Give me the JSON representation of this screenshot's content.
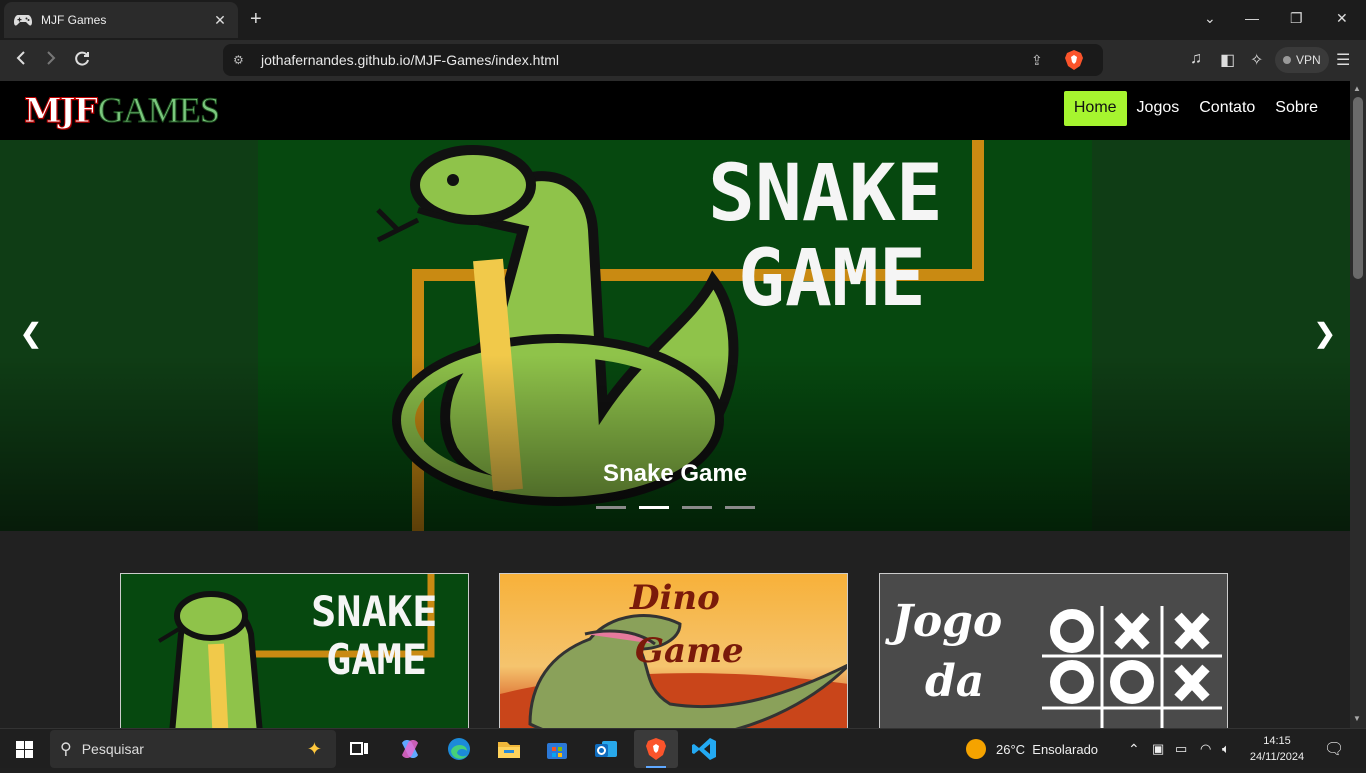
{
  "browser": {
    "tab_title": "MJF Games",
    "url": "jothafernandes.github.io/MJF-Games/index.html",
    "vpn_label": "VPN"
  },
  "site": {
    "logo_mjf": "MJF",
    "logo_games": "GAMES",
    "menu": [
      "Home",
      "Jogos",
      "Contato",
      "Sobre"
    ],
    "active_menu": "Home"
  },
  "carousel": {
    "caption": "Snake Game",
    "banner_title_line1": "SNAKE",
    "banner_title_line2": "GAME",
    "prev_symbol": "❮",
    "next_symbol": "❯",
    "indicator_count": 4,
    "active_indicator": 2
  },
  "cards": [
    {
      "line1": "SNAKE",
      "line2": "GAME",
      "bg": "#06480f"
    },
    {
      "line1": "Dino",
      "line2": "Game",
      "bg": "#f5a93b"
    },
    {
      "line1": "Jogo",
      "line2": "da",
      "bg": "#4a4a4a"
    }
  ],
  "taskbar": {
    "search_placeholder": "Pesquisar",
    "weather": "26°C  Ensolarado",
    "time": "14:15",
    "date": "24/11/2024"
  },
  "colors": {
    "menu_active": "#a6f52f",
    "snake_bg": "#06480f"
  }
}
